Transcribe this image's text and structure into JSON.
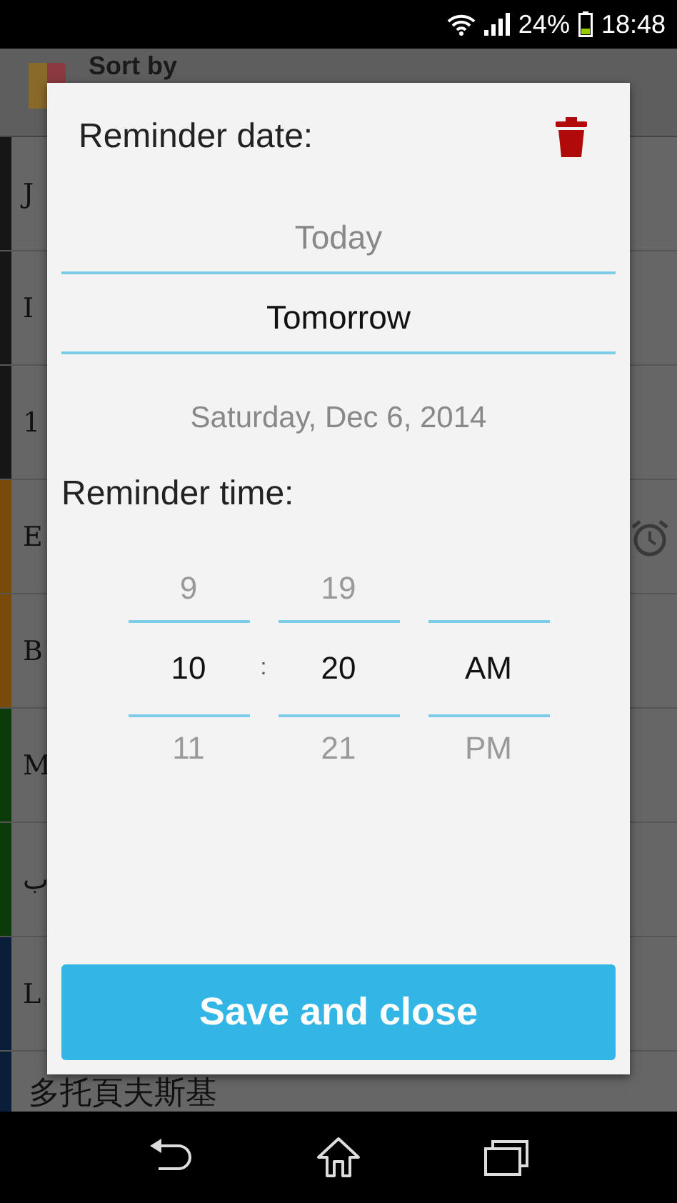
{
  "status_bar": {
    "battery": "24%",
    "time": "18:48"
  },
  "app_bar": {
    "title": "Sort by"
  },
  "list": [
    {
      "initial": "J",
      "color": "#161616",
      "alarm": false
    },
    {
      "initial": "I",
      "color": "#161616",
      "alarm": false
    },
    {
      "initial": "1",
      "color": "#161616",
      "alarm": false
    },
    {
      "initial": "E",
      "color": "#7a4a0a",
      "alarm": true
    },
    {
      "initial": "B",
      "color": "#7a4a0a",
      "alarm": false
    },
    {
      "initial": "M",
      "color": "#0b3a0b",
      "alarm": false
    },
    {
      "initial": "ب",
      "color": "#0b3a0b",
      "alarm": false
    },
    {
      "initial": "L",
      "color": "#0a1e3a",
      "alarm": false
    },
    {
      "initial": "多托頁夫斯基",
      "color": "#0a1e3a",
      "alarm": false
    }
  ],
  "dialog": {
    "date_label": "Reminder date:",
    "date_options": [
      {
        "label": "Today",
        "selected": false
      },
      {
        "label": "Tomorrow",
        "selected": true
      }
    ],
    "date": "Saturday, Dec 6, 2014",
    "time_label": "Reminder time:",
    "pickers": [
      {
        "above": "9",
        "value": "10",
        "below": "11"
      },
      {
        "above": "19",
        "value": "20",
        "below": "21"
      },
      {
        "value": "AM",
        "below": "PM"
      }
    ],
    "separator": ":",
    "button": "Save and close"
  }
}
